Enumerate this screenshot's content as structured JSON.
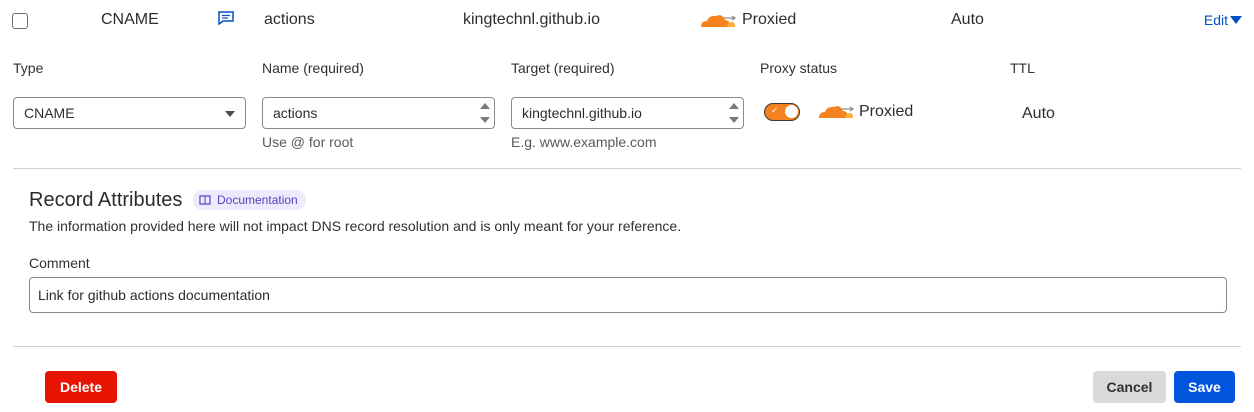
{
  "record": {
    "type": "CNAME",
    "name": "actions",
    "content": "kingtechnl.github.io",
    "proxy_status": "Proxied",
    "ttl": "Auto",
    "edit_label": "Edit"
  },
  "form": {
    "type_label": "Type",
    "type_value": "CNAME",
    "name_label": "Name (required)",
    "name_value": "actions",
    "name_hint": "Use @ for root",
    "target_label": "Target (required)",
    "target_value": "kingtechnl.github.io",
    "target_hint": "E.g. www.example.com",
    "proxy_label": "Proxy status",
    "proxy_value": "Proxied",
    "proxy_enabled": true,
    "ttl_label": "TTL",
    "ttl_value": "Auto"
  },
  "attributes": {
    "title": "Record Attributes",
    "doc_badge": "Documentation",
    "description": "The information provided here will not impact DNS record resolution and is only meant for your reference.",
    "comment_label": "Comment",
    "comment_value": "Link for github actions documentation"
  },
  "actions": {
    "delete_label": "Delete",
    "cancel_label": "Cancel",
    "save_label": "Save"
  },
  "colors": {
    "accent_orange": "#f6821f",
    "link_blue": "#0051c3",
    "delete_red": "#e81403",
    "save_blue": "#0055dc"
  }
}
